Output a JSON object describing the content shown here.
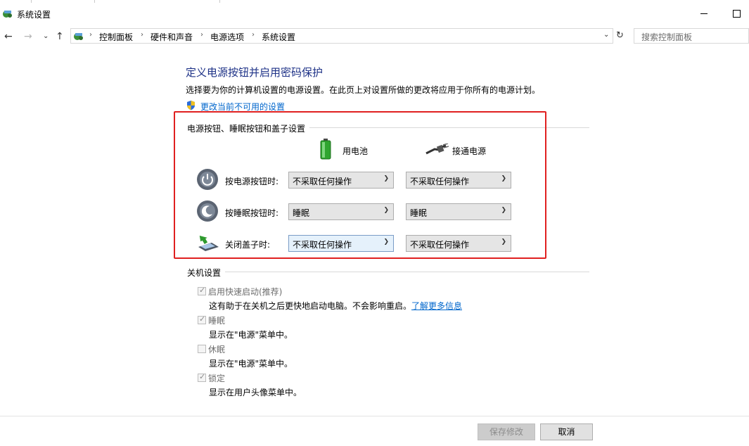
{
  "window": {
    "title": "系统设置"
  },
  "address": {
    "crumbs": [
      "控制面板",
      "硬件和声音",
      "电源选项",
      "系统设置"
    ],
    "search_placeholder": "搜索控制面板"
  },
  "page": {
    "heading": "定义电源按钮并启用密码保护",
    "description": "选择要为你的计算机设置的电源设置。在此页上对设置所做的更改将应用于你所有的电源计划。",
    "change_link": "更改当前不可用的设置"
  },
  "buttons_section": {
    "title": "电源按钮、睡眠按钮和盖子设置",
    "battery_label": "用电池",
    "plugged_label": "接通电源",
    "rows": [
      {
        "label": "按电源按钮时:",
        "battery": "不采取任何操作",
        "plugged": "不采取任何操作"
      },
      {
        "label": "按睡眠按钮时:",
        "battery": "睡眠",
        "plugged": "睡眠"
      },
      {
        "label": "关闭盖子时:",
        "battery": "不采取任何操作",
        "plugged": "不采取任何操作"
      }
    ]
  },
  "shutdown_section": {
    "title": "关机设置",
    "options": [
      {
        "label": "启用快速启动(推荐)",
        "checked": true,
        "desc": "这有助于在关机之后更快地启动电脑。不会影响重启。",
        "link": "了解更多信息"
      },
      {
        "label": "睡眠",
        "checked": true,
        "desc": "显示在\"电源\"菜单中。"
      },
      {
        "label": "休眠",
        "checked": false,
        "desc": "显示在\"电源\"菜单中。"
      },
      {
        "label": "锁定",
        "checked": true,
        "desc": "显示在用户头像菜单中。"
      }
    ]
  },
  "footer": {
    "save_label": "保存修改",
    "cancel_label": "取消"
  },
  "colors": {
    "heading": "#1e3287",
    "link": "#0066cc",
    "highlight_box": "#e02020"
  }
}
